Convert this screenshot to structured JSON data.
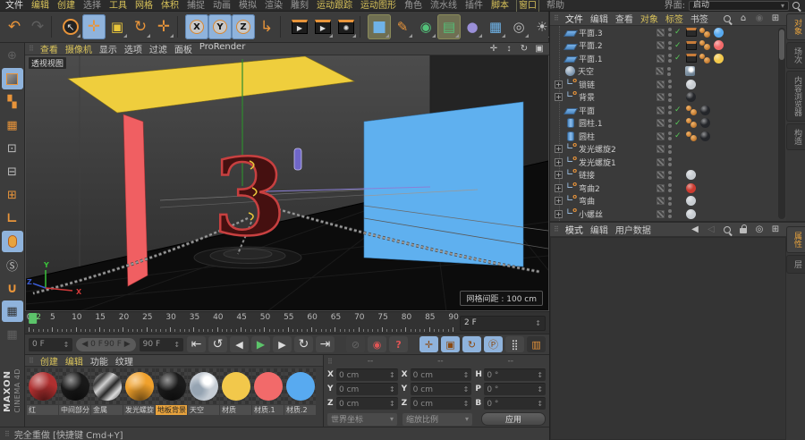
{
  "colors": {
    "accent": "#e8943a",
    "selection": "#8fb3dc",
    "menu_highlight": "#d9c35a",
    "plane_yellow": "#efce3d",
    "plane_red": "#f05f62",
    "plane_blue": "#5fb0ef",
    "playhead_green": "#5cc46a"
  },
  "menubar": {
    "items": [
      {
        "label": "文件",
        "cls": "wh"
      },
      {
        "label": "编辑",
        "cls": "hl"
      },
      {
        "label": "创建",
        "cls": "hl"
      },
      {
        "label": "选择",
        "cls": ""
      },
      {
        "label": "工具",
        "cls": "hl"
      },
      {
        "label": "网格",
        "cls": "hl"
      },
      {
        "label": "体积",
        "cls": "hl"
      },
      {
        "label": "捕捉",
        "cls": ""
      },
      {
        "label": "动画",
        "cls": ""
      },
      {
        "label": "模拟",
        "cls": ""
      },
      {
        "label": "渲染",
        "cls": ""
      },
      {
        "label": "雕刻",
        "cls": ""
      },
      {
        "label": "运动跟踪",
        "cls": "hl"
      },
      {
        "label": "运动图形",
        "cls": "hl"
      },
      {
        "label": "角色",
        "cls": ""
      },
      {
        "label": "流水线",
        "cls": ""
      },
      {
        "label": "插件",
        "cls": ""
      },
      {
        "label": "脚本",
        "cls": "hl"
      },
      {
        "label": "窗口",
        "cls": "hl box"
      },
      {
        "label": "帮助",
        "cls": ""
      }
    ],
    "interface_label": "界面:",
    "interface_value": "启动"
  },
  "toolbar": {
    "icons": [
      {
        "name": "undo-icon",
        "g": "↶",
        "cls": "or big"
      },
      {
        "name": "redo-icon",
        "g": "↷",
        "cls": "dim big"
      },
      {
        "name": "separator",
        "g": "",
        "cls": "sepbar"
      },
      {
        "name": "live-selection-icon",
        "g": "↖",
        "cls": "circ fly"
      },
      {
        "name": "move-tool-icon",
        "g": "✛",
        "cls": "or sel big"
      },
      {
        "name": "scale-tool-icon",
        "g": "▣",
        "cls": "yel fly"
      },
      {
        "name": "rotate-tool-icon",
        "g": "↻",
        "cls": "or big fly"
      },
      {
        "name": "last-tool-icon",
        "g": "✛",
        "cls": "or big fly"
      },
      {
        "name": "separator",
        "g": "",
        "cls": "sepbar"
      },
      {
        "name": "x-axis-lock-icon",
        "g": "X",
        "cls": "ax sel"
      },
      {
        "name": "y-axis-lock-icon",
        "g": "Y",
        "cls": "ax sel"
      },
      {
        "name": "z-axis-lock-icon",
        "g": "Z",
        "cls": "ax sel"
      },
      {
        "name": "coordinate-system-icon",
        "g": "↳",
        "cls": "or big"
      },
      {
        "name": "separator",
        "g": "",
        "cls": "sepbar"
      },
      {
        "name": "render-view-icon",
        "g": "▶",
        "cls": "clap"
      },
      {
        "name": "render-picture-viewer-icon",
        "g": "▶",
        "cls": "clap fly"
      },
      {
        "name": "render-settings-icon",
        "g": "✺",
        "cls": "clap fly"
      },
      {
        "name": "separator",
        "g": "",
        "cls": "sepbar"
      },
      {
        "name": "cube-primitive-icon",
        "g": "■",
        "cls": "blu sel2 big fly"
      },
      {
        "name": "pen-spline-icon",
        "g": "✎",
        "cls": "or fly"
      },
      {
        "name": "subdivision-surface-icon",
        "g": "◉",
        "cls": "grn fly"
      },
      {
        "name": "cloner-array-icon",
        "g": "▤",
        "cls": "grn sel2 fly"
      },
      {
        "name": "deformer-icon",
        "g": "●",
        "cls": "pur fly"
      },
      {
        "name": "floor-environment-icon",
        "g": "▦",
        "cls": "blu fly"
      },
      {
        "name": "camera-icon",
        "g": "◎",
        "cls": "gry fly"
      },
      {
        "name": "light-icon",
        "g": "☀",
        "cls": "gry fly"
      }
    ]
  },
  "left_toolbar": {
    "icons": [
      {
        "name": "world-grid-icon",
        "g": "⊕",
        "cls": "dim"
      },
      {
        "name": "model-mode-icon",
        "g": "",
        "cls": "sel cube"
      },
      {
        "name": "texture-mode-icon",
        "g": "▚",
        "cls": "or"
      },
      {
        "name": "workplane-grid-icon",
        "g": "▦",
        "cls": "or"
      },
      {
        "name": "points-mode-icon",
        "g": "⊡",
        "cls": ""
      },
      {
        "name": "edges-mode-icon",
        "g": "⊟",
        "cls": ""
      },
      {
        "name": "polygons-mode-icon",
        "g": "⊞",
        "cls": "or"
      },
      {
        "name": "object-axis-icon",
        "g": "∟",
        "cls": "or bold"
      },
      {
        "name": "viewport-mouse-icon",
        "g": "",
        "cls": "sel mouse"
      },
      {
        "name": "snap-icon",
        "g": "Ⓢ",
        "cls": ""
      },
      {
        "name": "magnet-snap-icon",
        "g": "∪",
        "cls": "or bold"
      },
      {
        "name": "workplane-lock-icon",
        "g": "▦",
        "cls": "sel"
      },
      {
        "name": "workplane-local-icon",
        "g": "▦",
        "cls": "dim"
      }
    ]
  },
  "viewport": {
    "menus": [
      {
        "label": "查看",
        "cls": "hl"
      },
      {
        "label": "摄像机",
        "cls": "hl"
      },
      {
        "label": "显示",
        "cls": ""
      },
      {
        "label": "选项",
        "cls": ""
      },
      {
        "label": "过滤",
        "cls": ""
      },
      {
        "label": "面板",
        "cls": ""
      },
      {
        "label": "ProRender",
        "cls": ""
      }
    ],
    "nav_icons": [
      {
        "name": "pan-view-icon",
        "g": "✛"
      },
      {
        "name": "dolly-view-icon",
        "g": "↕"
      },
      {
        "name": "orbit-view-icon",
        "g": "↻"
      },
      {
        "name": "toggle-panel-icon",
        "g": "▣"
      }
    ],
    "view_label": "透视视图",
    "grid_label": "网格间距 : 100 cm",
    "axis": {
      "x": "X",
      "y": "Y",
      "z": "Z"
    }
  },
  "timeline": {
    "max": 90,
    "current_frame": 2,
    "current": "2 F",
    "labels": [
      {
        "f": 0,
        "t": "0"
      },
      {
        "f": 2,
        "t": "2",
        "hl": true
      },
      {
        "f": 5,
        "t": "5"
      },
      {
        "f": 10,
        "t": "10"
      },
      {
        "f": 15,
        "t": "15"
      },
      {
        "f": 20,
        "t": "20"
      },
      {
        "f": 25,
        "t": "25"
      },
      {
        "f": 30,
        "t": "30"
      },
      {
        "f": 35,
        "t": "35"
      },
      {
        "f": 40,
        "t": "40"
      },
      {
        "f": 45,
        "t": "45"
      },
      {
        "f": 50,
        "t": "50"
      },
      {
        "f": 55,
        "t": "55"
      },
      {
        "f": 60,
        "t": "60"
      },
      {
        "f": 65,
        "t": "65"
      },
      {
        "f": 70,
        "t": "70"
      },
      {
        "f": 75,
        "t": "75"
      },
      {
        "f": 80,
        "t": "80"
      },
      {
        "f": 85,
        "t": "85"
      },
      {
        "f": 90,
        "t": "90"
      }
    ]
  },
  "transport": {
    "start": "0 F",
    "range_left": "◀ 0 F",
    "range_right": "90 F ▶",
    "end": "90 F",
    "buttons": [
      {
        "name": "goto-start-button",
        "g": "⇤",
        "cls": "big"
      },
      {
        "name": "play-backwards-button",
        "g": "↺",
        "cls": "big"
      },
      {
        "name": "previous-frame-button",
        "g": "◀",
        "cls": ""
      },
      {
        "name": "play-forwards-button",
        "g": "▶",
        "cls": "play"
      },
      {
        "name": "next-frame-button",
        "g": "▶",
        "cls": ""
      },
      {
        "name": "play-loop-button",
        "g": "↻",
        "cls": "big"
      },
      {
        "name": "goto-end-button",
        "g": "⇥",
        "cls": "big"
      },
      {
        "name": "record-active-objects-button",
        "g": "⊘",
        "cls": "dim gap"
      },
      {
        "name": "autokeying-button",
        "g": "◉",
        "cls": "rec"
      },
      {
        "name": "keyframe-selection-button",
        "g": "?",
        "cls": "rec"
      },
      {
        "name": "key-position-button",
        "g": "✛",
        "cls": "sel gap"
      },
      {
        "name": "key-scale-button",
        "g": "▣",
        "cls": "sel"
      },
      {
        "name": "key-rotation-button",
        "g": "↻",
        "cls": "sel"
      },
      {
        "name": "key-parameter-button",
        "g": "Ⓟ",
        "cls": "sel"
      },
      {
        "name": "key-point-level-button",
        "g": "⣿",
        "cls": ""
      },
      {
        "name": "timeline-mode-button",
        "g": "▥",
        "cls": "film"
      }
    ]
  },
  "materials": {
    "menus": [
      {
        "label": "创建",
        "cls": "hl"
      },
      {
        "label": "编辑",
        "cls": "hl"
      },
      {
        "label": "功能",
        "cls": ""
      },
      {
        "label": "纹理",
        "cls": ""
      }
    ],
    "items": [
      {
        "name": "红",
        "color": "#b03030",
        "cls": "ball"
      },
      {
        "name": "中间部分",
        "color": "#191919",
        "cls": "ball"
      },
      {
        "name": "金属",
        "color": "#8d8d8d",
        "cls": "chrome"
      },
      {
        "name": "发光螺旋",
        "color": "#f0a12c",
        "cls": "ball"
      },
      {
        "name": "地板背景",
        "color": "#1b1b1b",
        "cls": "ball",
        "sel": "sel"
      },
      {
        "name": "天空",
        "color": "#c5ccd4",
        "cls": "sky"
      },
      {
        "name": "材质",
        "color": "#f2c84b",
        "cls": "flat"
      },
      {
        "name": "材质.1",
        "color": "#f26a6a",
        "cls": "flat"
      },
      {
        "name": "材质.2",
        "color": "#58aaf0",
        "cls": "flat"
      }
    ]
  },
  "coords": {
    "headers": [
      "--",
      "--",
      "--"
    ],
    "rows": [
      {
        "l1": "X",
        "v1": "0 cm",
        "l2": "X",
        "v2": "0 cm",
        "l3": "H",
        "v3": "0 °"
      },
      {
        "l1": "Y",
        "v1": "0 cm",
        "l2": "Y",
        "v2": "0 cm",
        "l3": "P",
        "v3": "0 °"
      },
      {
        "l1": "Z",
        "v1": "0 cm",
        "l2": "Z",
        "v2": "0 cm",
        "l3": "B",
        "v3": "0 °"
      }
    ],
    "mode1": "世界坐标",
    "mode2": "缩放比例",
    "apply": "应用"
  },
  "object_manager": {
    "menus": [
      {
        "label": "文件",
        "cls": "wh"
      },
      {
        "label": "编辑",
        "cls": ""
      },
      {
        "label": "查看",
        "cls": ""
      },
      {
        "label": "对象",
        "cls": "hl"
      },
      {
        "label": "标签",
        "cls": "hl"
      },
      {
        "label": "书签",
        "cls": ""
      }
    ],
    "icons": [
      {
        "name": "search-icon",
        "g": "",
        "cls": "magg"
      },
      {
        "name": "home-icon",
        "g": "⌂",
        "cls": ""
      },
      {
        "name": "filter-icon",
        "g": "◉",
        "cls": "dim"
      },
      {
        "name": "add-icon",
        "g": "⊞",
        "cls": ""
      }
    ],
    "tabs": [
      {
        "label": "对象",
        "cls": "active"
      },
      {
        "label": "场次",
        "cls": ""
      },
      {
        "label": "内容浏览器",
        "cls": ""
      },
      {
        "label": "构造",
        "cls": ""
      }
    ],
    "rows": [
      {
        "exp": "",
        "icon": "plane",
        "name": "平面.3",
        "cls": "chk slate phong",
        "mat": "#58aaf0"
      },
      {
        "exp": "",
        "icon": "plane",
        "name": "平面.2",
        "cls": "chk slate phong",
        "mat": "#f26a6a"
      },
      {
        "exp": "",
        "icon": "plane",
        "name": "平面.1",
        "cls": "chk slate phong",
        "mat": "#f2c84b"
      },
      {
        "exp": "",
        "icon": "sky",
        "name": "天空",
        "cls": "textag",
        "mat": ""
      },
      {
        "exp": "+",
        "icon": "null",
        "name": "锁链",
        "cls": "",
        "mat": "#c8cdd2"
      },
      {
        "exp": "+",
        "icon": "null",
        "name": "背景",
        "cls": "",
        "mat": "#24262a"
      },
      {
        "exp": "",
        "icon": "plane",
        "name": "平面",
        "cls": "chk phong",
        "mat": "#24262a"
      },
      {
        "exp": "",
        "icon": "cyl",
        "name": "圆柱.1",
        "cls": "chk phong",
        "mat": "#24262a"
      },
      {
        "exp": "",
        "icon": "cyl",
        "name": "圆柱",
        "cls": "chk phong",
        "mat": "#24262a"
      },
      {
        "exp": "+",
        "icon": "null",
        "name": "发光螺旋2",
        "cls": "",
        "mat": ""
      },
      {
        "exp": "+",
        "icon": "null",
        "name": "发光螺旋1",
        "cls": "",
        "mat": ""
      },
      {
        "exp": "+",
        "icon": "null",
        "name": "链接",
        "cls": "",
        "mat": "#c8cdd2"
      },
      {
        "exp": "+",
        "icon": "null",
        "name": "弯曲2",
        "cls": "",
        "mat": "#cc3b30"
      },
      {
        "exp": "+",
        "icon": "null",
        "name": "弯曲",
        "cls": "",
        "mat": "#c8cdd2"
      },
      {
        "exp": "+",
        "icon": "null",
        "name": "小螺丝",
        "cls": "",
        "mat": "#c8cdd2"
      }
    ]
  },
  "attribute_manager": {
    "menus": [
      {
        "label": "模式",
        "cls": "wh"
      },
      {
        "label": "编辑",
        "cls": ""
      },
      {
        "label": "用户数据",
        "cls": ""
      }
    ],
    "icons": [
      {
        "name": "history-back-icon",
        "g": "◀",
        "cls": ""
      },
      {
        "name": "history-forward-icon",
        "g": "◁",
        "cls": "dim"
      },
      {
        "name": "search-icon",
        "g": "",
        "cls": "magg"
      },
      {
        "name": "lock-icon",
        "g": "",
        "cls": "lockg"
      },
      {
        "name": "focus-icon",
        "g": "◎",
        "cls": ""
      },
      {
        "name": "add-icon",
        "g": "⊞",
        "cls": ""
      }
    ],
    "tabs": [
      {
        "label": "属性",
        "cls": "active"
      },
      {
        "label": "层",
        "cls": ""
      }
    ]
  },
  "statusbar": {
    "text": "完全重做 [快捷键 Cmd+Y]"
  },
  "logo": {
    "brand": "MAXON",
    "product": "CINEMA 4D"
  }
}
